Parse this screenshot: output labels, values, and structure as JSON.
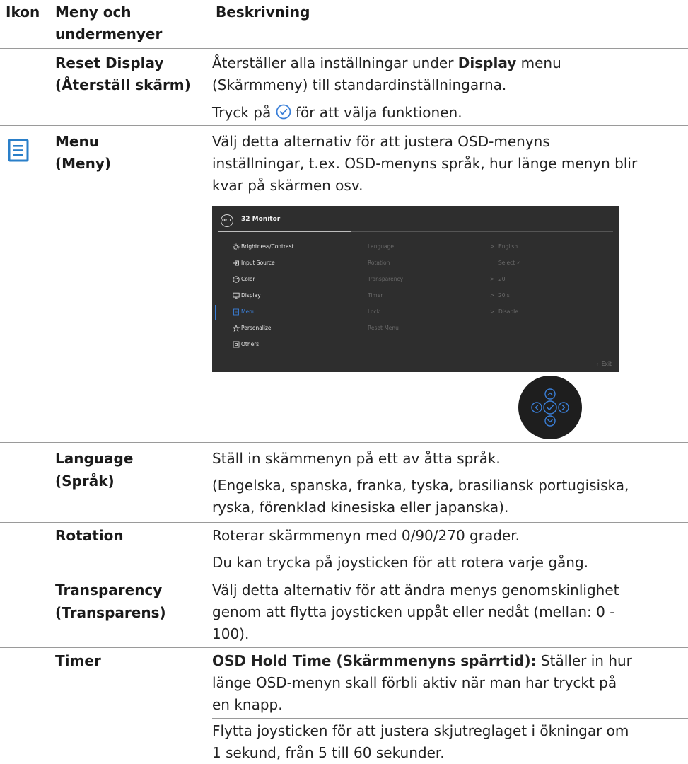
{
  "header": {
    "col1": "Ikon",
    "col2_line1": "Meny och",
    "col2_line2": "undermenyer",
    "col3": "Beskrivning"
  },
  "reset": {
    "name_line1": "Reset Display",
    "name_line2": "(Återställ skärm)",
    "desc_pre": "Återställer alla inställningar under ",
    "desc_bold": "Display",
    "desc_post": " menu",
    "desc_line2": "(Skärmmeny) till standardinställningarna.",
    "press_pre": "Tryck på ",
    "press_post": " för att välja funktionen."
  },
  "menu": {
    "name_line1": "Menu",
    "name_line2": "(Meny)",
    "desc_line1": "Välj detta alternativ för att justera OSD-menyns",
    "desc_line2": "inställningar, t.ex. OSD-menyns språk, hur länge menyn blir",
    "desc_line3": "kvar på skärmen osv."
  },
  "osd": {
    "logo": "DELL",
    "model": "32 Monitor",
    "main_items": [
      "Brightness/Contrast",
      "Input Source",
      "Color",
      "Display",
      "Menu",
      "Personalize",
      "Others"
    ],
    "active_index": 4,
    "sub_items": [
      "Language",
      "Rotation",
      "Transparency",
      "Timer",
      "Lock",
      "Reset Menu"
    ],
    "sub_values": [
      "English",
      "Select",
      "20",
      "20 s",
      "Disable",
      ""
    ],
    "sub_arrows": [
      ">",
      "",
      ">",
      ">",
      ">",
      ""
    ],
    "exit": "Exit",
    "accent": "#3a7fd8"
  },
  "language": {
    "name_line1": "Language",
    "name_line2": "(Språk)",
    "desc_line1": "Ställ in skämmenyn på ett av åtta språk.",
    "desc_line2": "(Engelska, spanska, franka, tyska, brasiliansk portugisiska,",
    "desc_line3": "ryska, förenklad kinesiska eller japanska)."
  },
  "rotation": {
    "name": "Rotation",
    "desc_line1": "Roterar skärmmenyn med 0/90/270 grader.",
    "desc_line2": "Du kan trycka på joysticken för att rotera varje gång."
  },
  "transparency": {
    "name_line1": "Transparency",
    "name_line2": "(Transparens)",
    "desc_line1": "Välj detta alternativ för att ändra menys genomskinlighet",
    "desc_line2": "genom att flytta joysticken uppåt eller nedåt (mellan: 0 -",
    "desc_line3": "100)."
  },
  "timer": {
    "name": "Timer",
    "desc_bold": "OSD Hold Time (Skärmmenyns spärrtid):",
    "desc_rest": " Ställer in hur",
    "desc_line2": "länge OSD-menyn skall förbli aktiv när man har tryckt på",
    "desc_line3": "en knapp.",
    "desc_line4": "Flytta joysticken för att justera skjutreglaget i ökningar om",
    "desc_line5": "1 sekund, från 5 till 60 sekunder."
  }
}
